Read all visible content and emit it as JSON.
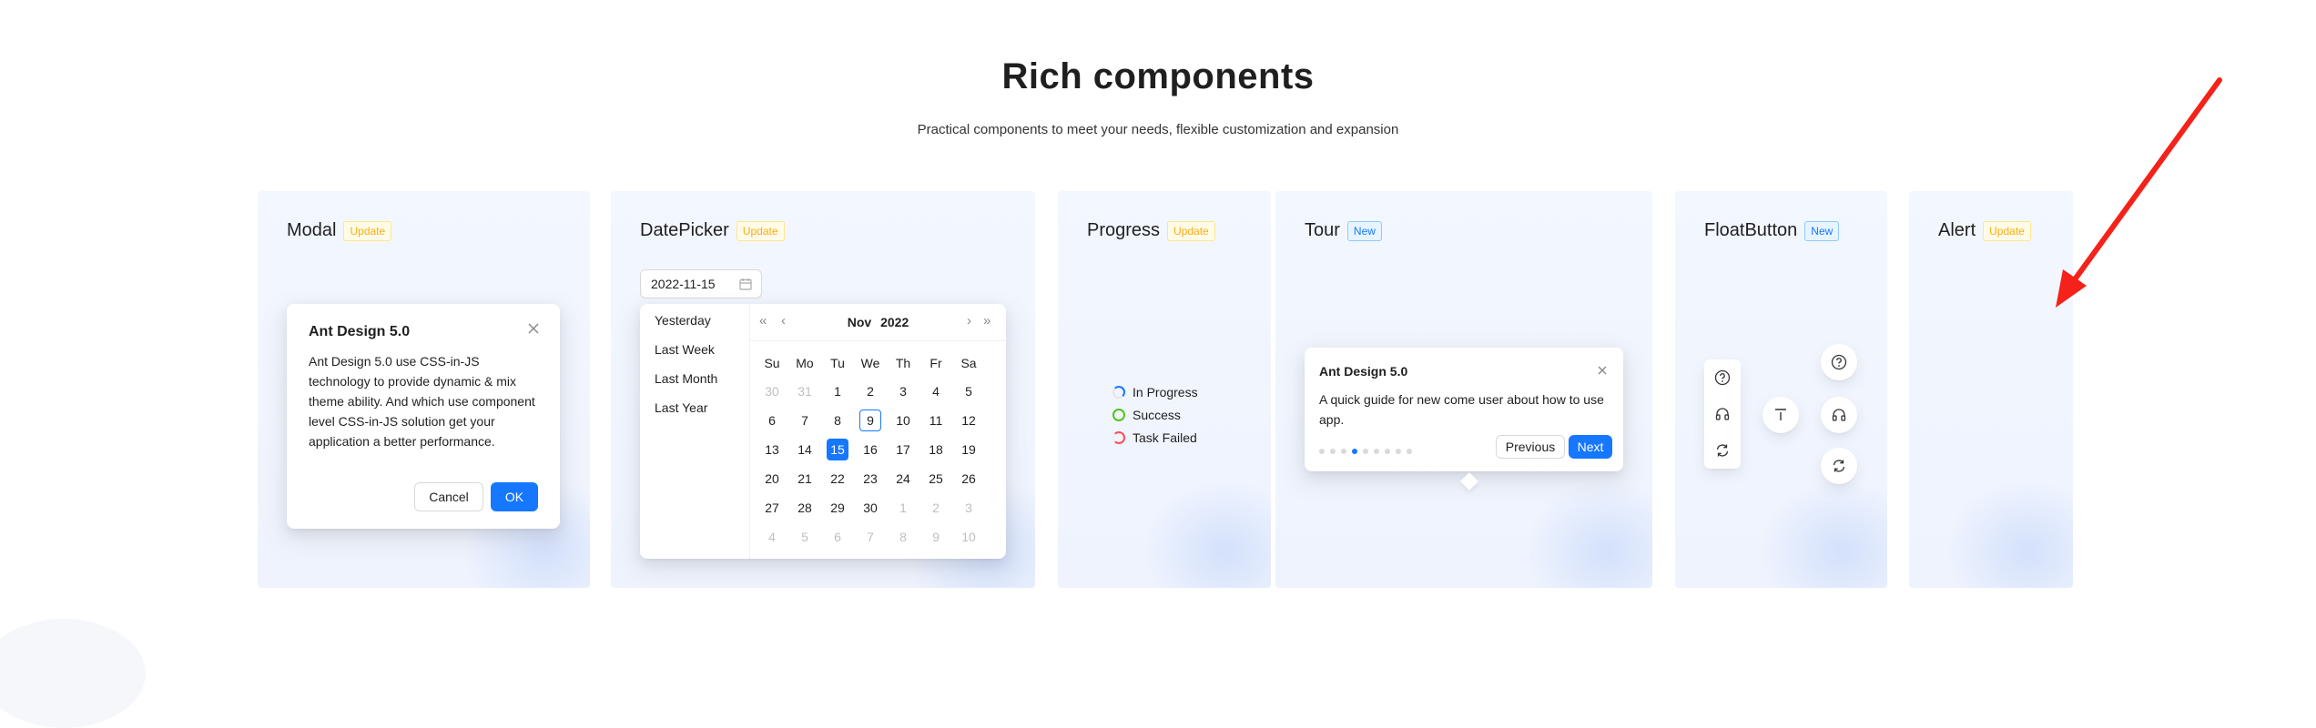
{
  "header": {
    "title": "Rich components",
    "subtitle": "Practical components to meet your needs, flexible customization and expansion"
  },
  "colors": {
    "primary": "#1677ff",
    "update_tag": "#faad14",
    "new_tag": "#1677ff",
    "success": "#52c41a",
    "error": "#ff4d4f",
    "arrow": "#f5221a"
  },
  "cards": {
    "modal": {
      "title": "Modal",
      "tag": "Update",
      "dialog": {
        "title": "Ant Design 5.0",
        "body": "Ant Design 5.0 use CSS-in-JS technology to provide dynamic & mix theme ability. And which use component level CSS-in-JS solution get your application a better performance.",
        "cancel": "Cancel",
        "ok": "OK",
        "close_icon": "close-icon"
      }
    },
    "datepicker": {
      "title": "DatePicker",
      "tag": "Update",
      "value": "2022-11-15",
      "input_icon": "calendar-icon",
      "presets": [
        "Yesterday",
        "Last Week",
        "Last Month",
        "Last Year"
      ],
      "month": "Nov",
      "year": "2022",
      "weekdays": [
        "Su",
        "Mo",
        "Tu",
        "We",
        "Th",
        "Fr",
        "Sa"
      ],
      "weeks": [
        [
          "30",
          "31",
          "1",
          "2",
          "3",
          "4",
          "5"
        ],
        [
          "6",
          "7",
          "8",
          "9",
          "10",
          "11",
          "12"
        ],
        [
          "13",
          "14",
          "15",
          "16",
          "17",
          "18",
          "19"
        ],
        [
          "20",
          "21",
          "22",
          "23",
          "24",
          "25",
          "26"
        ],
        [
          "27",
          "28",
          "29",
          "30",
          "1",
          "2",
          "3"
        ],
        [
          "4",
          "5",
          "6",
          "7",
          "8",
          "9",
          "10"
        ]
      ],
      "today": "9",
      "selected": "15"
    },
    "progress": {
      "title": "Progress",
      "tag": "Update",
      "items": [
        {
          "label": "In Progress",
          "status": "active",
          "percent": 30
        },
        {
          "label": "Success",
          "status": "success",
          "percent": 100
        },
        {
          "label": "Task Failed",
          "status": "exception",
          "percent": 70
        }
      ]
    },
    "tour": {
      "title": "Tour",
      "tag": "New",
      "popup": {
        "title": "Ant Design 5.0",
        "body": "A quick guide for new come user about how to use app.",
        "previous": "Previous",
        "next": "Next",
        "steps_total": 9,
        "current_step": 4,
        "close_icon": "close-icon"
      }
    },
    "floatbutton": {
      "title": "FloatButton",
      "tag": "New",
      "group_icons": [
        "question-icon",
        "headphones-icon",
        "sync-icon"
      ],
      "back_top_icon": "vertical-align-top-icon",
      "circle_icons": [
        "question-icon",
        "headphones-icon",
        "sync-icon"
      ]
    },
    "alert": {
      "title": "Alert",
      "tag": "Update"
    }
  }
}
